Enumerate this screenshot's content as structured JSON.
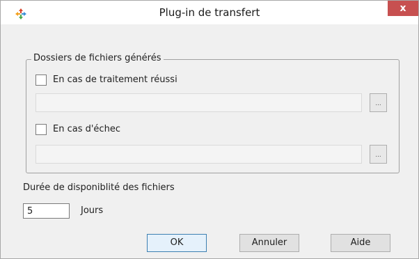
{
  "window": {
    "title": "Plug-in de transfert",
    "close_glyph": "x",
    "app_icon": "plugin-transfer-icon",
    "accent_close": "#c75050"
  },
  "generated_files_group": {
    "legend": "Dossiers de fichiers générés",
    "on_success": {
      "label": "En cas de traitement réussi",
      "checked": false,
      "path_value": "",
      "browse_label": "..."
    },
    "on_failure": {
      "label": "En cas d'échec",
      "checked": false,
      "path_value": "",
      "browse_label": "..."
    }
  },
  "availability": {
    "label": "Durée de disponiblité des fichiers",
    "value": "5",
    "unit": "Jours"
  },
  "buttons": {
    "ok": "OK",
    "cancel": "Annuler",
    "help": "Aide"
  }
}
